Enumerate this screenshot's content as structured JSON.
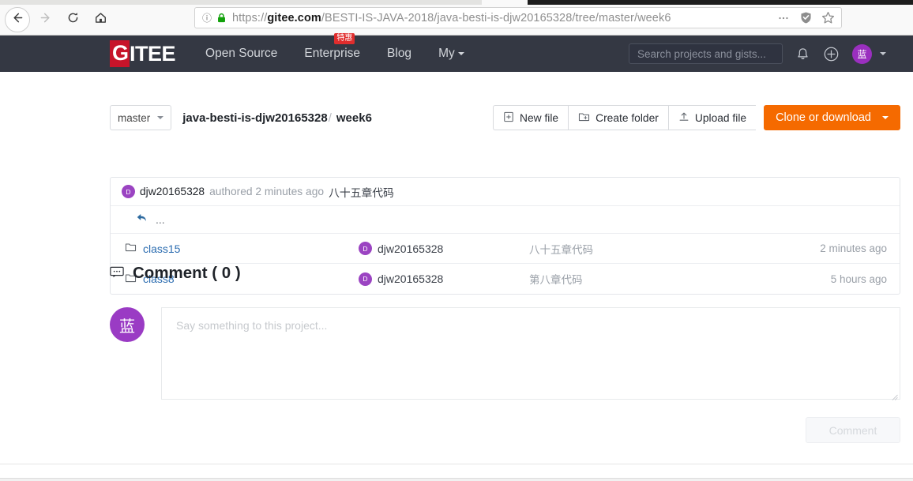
{
  "browser": {
    "back_icon": "back-arrow-icon",
    "forward_icon": "forward-arrow-icon",
    "reload_icon": "reload-icon",
    "home_icon": "home-icon",
    "info_icon": "page-info-icon",
    "lock_icon": "lock-icon",
    "url_host": "gitee.com",
    "url_prefix": "https://",
    "url_path": "/BESTI-IS-JAVA-2018/java-besti-is-djw20165328/tree/master/week6",
    "menu_icon": "ellipsis-icon",
    "shield_icon": "shield-icon",
    "bookmark_icon": "star-icon"
  },
  "topnav": {
    "logo_g": "G",
    "logo_rest": "ITEE",
    "links": [
      {
        "label": "Open Source",
        "badge": ""
      },
      {
        "label": "Enterprise",
        "badge": "特惠"
      },
      {
        "label": "Blog",
        "badge": ""
      },
      {
        "label": "My",
        "badge": ""
      }
    ],
    "search_placeholder": "Search projects and gists...",
    "bell_icon": "bell-icon",
    "plus_icon": "plus-circle-icon",
    "avatar_text": "蓝",
    "avatar_caret_icon": "chevron-down-icon",
    "bg_color": "#343843",
    "logo_red": "#c7142a"
  },
  "toolbar": {
    "branch": "master",
    "breadcrumb_repo": "java-besti-is-djw20165328",
    "breadcrumb_sep": "/",
    "breadcrumb_folder": "week6",
    "new_file": "New file",
    "create_folder": "Create folder",
    "upload_file": "Upload file",
    "clone": "Clone or download",
    "clone_color": "#f56a00"
  },
  "commit": {
    "avatar_letter": "D",
    "author": "djw20165328",
    "meta": "authored 2 minutes ago",
    "message": "八十五章代码"
  },
  "files": {
    "parent_label": "...",
    "parent_icon": "back-reply-arrow-icon",
    "rows": [
      {
        "icon": "folder-icon",
        "name": "class15",
        "avatar_letter": "D",
        "author": "djw20165328",
        "message": "八十五章代码",
        "time": "2 minutes ago"
      },
      {
        "icon": "folder-icon",
        "name": "class8",
        "avatar_letter": "D",
        "author": "djw20165328",
        "message": "第八章代码",
        "time": "5 hours ago"
      }
    ]
  },
  "comments": {
    "icon": "comment-bubble-icon",
    "title": "Comment ( 0 )",
    "avatar_text": "蓝",
    "placeholder": "Say something to this project...",
    "value": "",
    "submit_label": "Comment"
  }
}
